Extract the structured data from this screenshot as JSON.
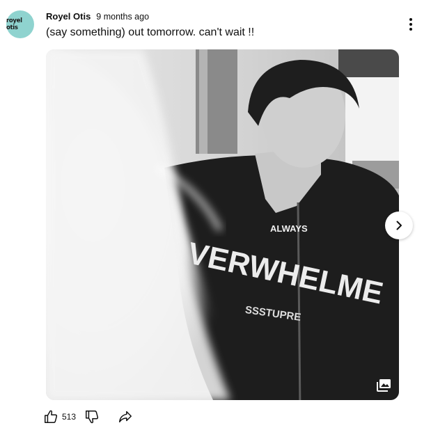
{
  "channel": {
    "avatar_text": "royel otis",
    "name": "Royel Otis",
    "time": "9 months ago"
  },
  "post": {
    "text": "(say something) out tomorrow. can't wait !!"
  },
  "image": {
    "hoodie_top_text": "ALWAYS",
    "hoodie_main_text": "VERWHELME",
    "hoodie_patch_text": "SSSTUPRE",
    "icon": "gallery-icon"
  },
  "actions": {
    "like_count": "513",
    "like_icon": "thumbs-up-icon",
    "dislike_icon": "thumbs-down-icon",
    "share_icon": "share-icon"
  },
  "controls": {
    "next_icon": "chevron-right-icon",
    "menu_icon": "more-vertical-icon"
  },
  "colors": {
    "avatar_bg": "#8fd3cf",
    "text": "#0f0f0f"
  }
}
